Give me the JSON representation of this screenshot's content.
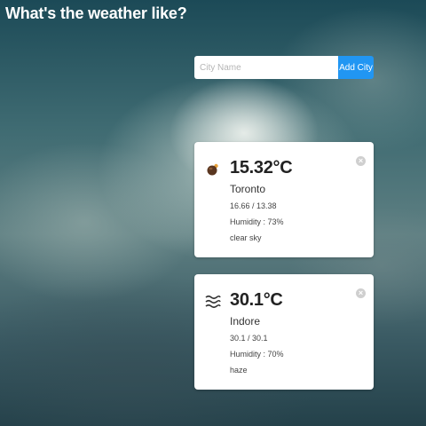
{
  "header": {
    "title": "What's the weather like?"
  },
  "search": {
    "placeholder": "City Name",
    "value": "",
    "button_label": "Add City"
  },
  "cards": [
    {
      "icon": "sun-partly-cloudy-icon",
      "temperature": "15.32°C",
      "city": "Toronto",
      "min_max": "16.66 / 13.38",
      "humidity": "Humidity : 73%",
      "description": "clear sky",
      "close_label": "×"
    },
    {
      "icon": "haze-icon",
      "temperature": "30.1°C",
      "city": "Indore",
      "min_max": "30.1 / 30.1",
      "humidity": "Humidity : 70%",
      "description": "haze",
      "close_label": "×"
    }
  ],
  "colors": {
    "accent": "#2196f3",
    "card_background": "#ffffff",
    "title_text": "#ffffff"
  }
}
